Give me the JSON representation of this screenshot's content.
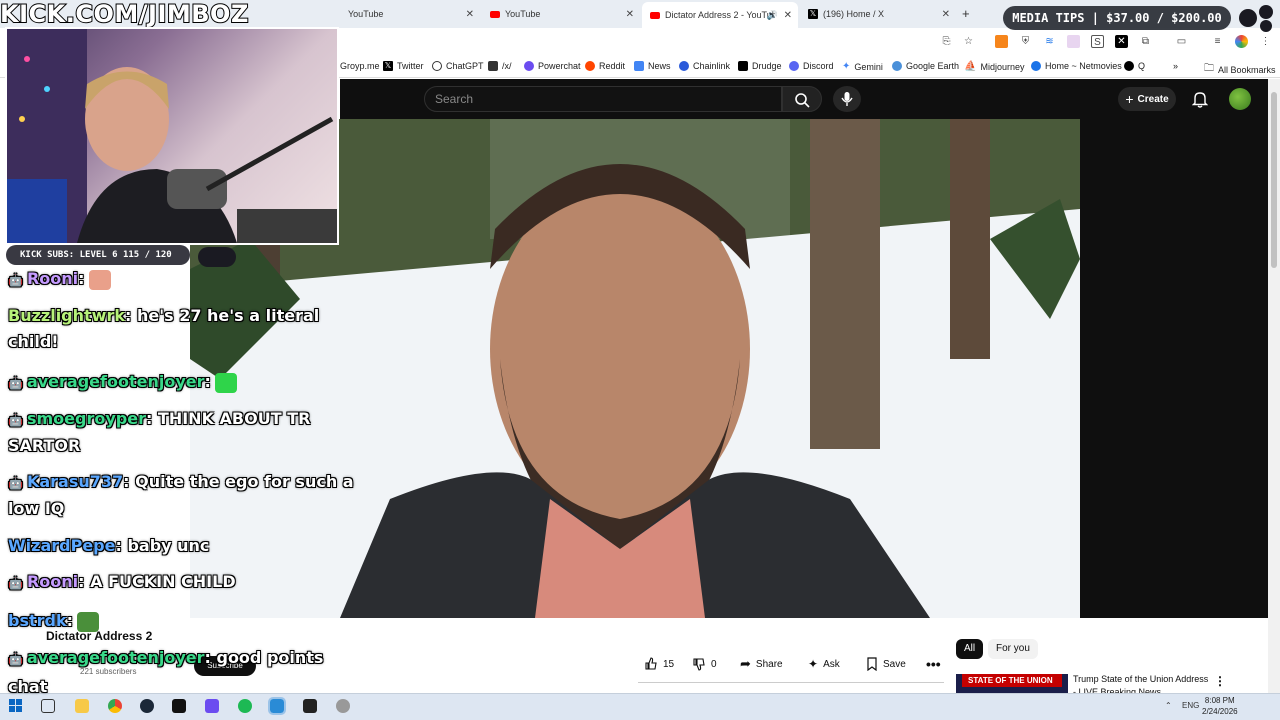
{
  "overlay": {
    "kick_url": "KICK.COM/JIMBOZ",
    "media_tips": "MEDIA TIPS | $37.00 / $200.00",
    "kick_subs": "KICK SUBS: LEVEL 6 115 / 120"
  },
  "tabs": [
    {
      "title": "YouTube"
    },
    {
      "title": "YouTube"
    },
    {
      "title": "Dictator Address 2 - YouTube"
    },
    {
      "title": "(196) Home / X"
    }
  ],
  "bookmarks": [
    {
      "label": "Groyp.me"
    },
    {
      "label": "Twitter"
    },
    {
      "label": "ChatGPT"
    },
    {
      "label": "/x/"
    },
    {
      "label": "Powerchat"
    },
    {
      "label": "Reddit"
    },
    {
      "label": "News"
    },
    {
      "label": "Chainlink"
    },
    {
      "label": "Drudge"
    },
    {
      "label": "Discord"
    },
    {
      "label": "Gemini"
    },
    {
      "label": "Google Earth"
    },
    {
      "label": "Midjourney"
    },
    {
      "label": "Home ~ Netmovies"
    },
    {
      "label": "Q"
    },
    {
      "label": "All Bookmarks"
    }
  ],
  "youtube": {
    "search_placeholder": "Search",
    "create_label": "Create",
    "video_title": "Dictator Address 2",
    "subscribers": "221 subscribers",
    "subscribe_label": "Subscribe",
    "likes": "15",
    "dislikes": "0",
    "share_label": "Share",
    "ask_label": "Ask",
    "save_label": "Save",
    "chip_all": "All",
    "chip_for_you": "For you",
    "rec_thumb_text": "STATE OF THE UNION",
    "rec_title": "Trump State of the Union Address - LIVE Breaking News"
  },
  "chat": [
    {
      "user": "Rooni",
      "color": "#c59bff",
      "message": ""
    },
    {
      "user": "Buzzlightwrk",
      "color": "#b7f27a",
      "message": "he's 27 he's a literal child!"
    },
    {
      "user": "averagefootenjoyer",
      "color": "#39d98a",
      "message": ""
    },
    {
      "user": "smoegroyper",
      "color": "#39d98a",
      "message": "THINK ABOUT TR SARTOR"
    },
    {
      "user": "Karasu737",
      "color": "#5aa7ff",
      "message": "Quite the ego for such a low IQ"
    },
    {
      "user": "WizardPepe",
      "color": "#5aa7ff",
      "message": "baby unc"
    },
    {
      "user": "Rooni",
      "color": "#c59bff",
      "message": "A FUCKIN CHILD"
    },
    {
      "user": "bstrdk",
      "color": "#5aa7ff",
      "message": ""
    },
    {
      "user": "averagefootenjoyer",
      "color": "#39d98a",
      "message": "good points"
    },
    {
      "user": "chat",
      "color": "#ffffff",
      "message": ""
    }
  ],
  "taskbar": {
    "language": "ENG",
    "time": "8:08 PM",
    "date": "2/24/2026"
  }
}
